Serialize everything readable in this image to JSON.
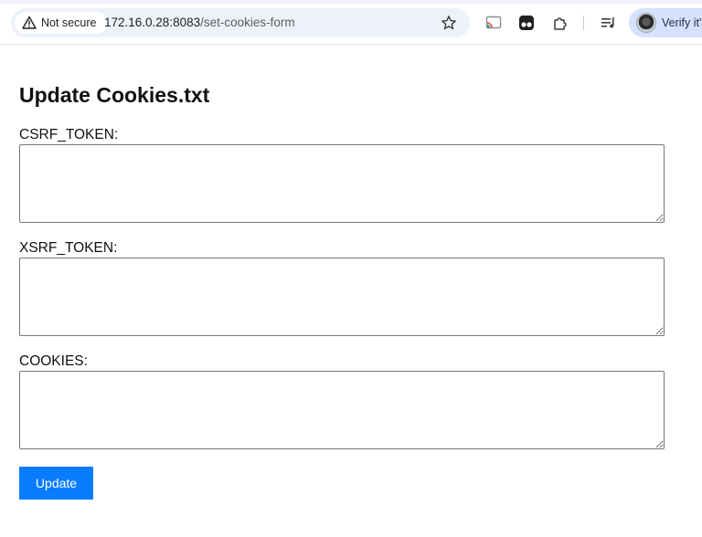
{
  "browser": {
    "security_label": "Not secure",
    "url_host": "172.16.0.28:8083",
    "url_path": "/set-cookies-form",
    "profile_label": "Verify it's"
  },
  "icons": {
    "security": "warning-triangle-icon",
    "bookmark": "star-icon",
    "cast": "cast-icon",
    "extension_a": "tampermonkey-icon",
    "extensions": "puzzle-icon",
    "media": "media-control-icon",
    "profile": "avatar"
  },
  "page": {
    "title": "Update Cookies.txt",
    "fields": [
      {
        "label": "CSRF_TOKEN:",
        "value": ""
      },
      {
        "label": "XSRF_TOKEN:",
        "value": ""
      },
      {
        "label": "COOKIES:",
        "value": ""
      }
    ],
    "submit_label": "Update"
  },
  "colors": {
    "button": "#0a7cff",
    "profile_chip": "#d6e2fb",
    "omnibox": "#edf1f8"
  }
}
